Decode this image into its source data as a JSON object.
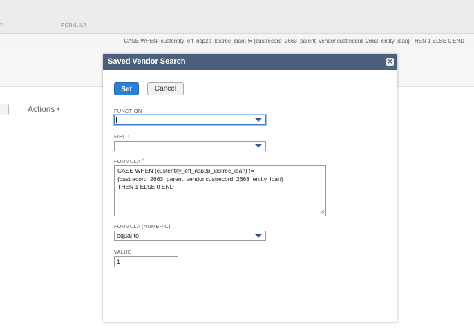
{
  "background": {
    "column_header": "FORMULA",
    "formula_row_text": "CASE WHEN {custentity_eff_nsp2p_lastrec_iban} != {custrecord_2663_parent_vendor.custrecord_2663_entity_iban} THEN 1 ELSE 0 END",
    "actions_label": "Actions"
  },
  "modal": {
    "title": "Saved Vendor Search",
    "close_icon": "close-icon",
    "set_label": "Set",
    "cancel_label": "Cancel",
    "function": {
      "label": "FUNCTION",
      "value": ""
    },
    "field": {
      "label": "FIELD",
      "value": ""
    },
    "formula": {
      "label": "FORMULA",
      "required_mark": "*",
      "lines": [
        "CASE WHEN {custentity_eff_nsp2p_lastrec_iban} !=",
        "{custrecord_2663_parent_vendor.custrecord_2663_entity_iban}",
        "THEN 1 ELSE 0 END"
      ]
    },
    "formula_numeric": {
      "label": "FORMULA (NUMERIC)",
      "value": "equal to"
    },
    "value": {
      "label": "VALUE",
      "value": "1"
    }
  },
  "colors": {
    "header_bg": "#4a607c",
    "primary_button": "#2a7fd6",
    "required_star": "#f5a623"
  }
}
